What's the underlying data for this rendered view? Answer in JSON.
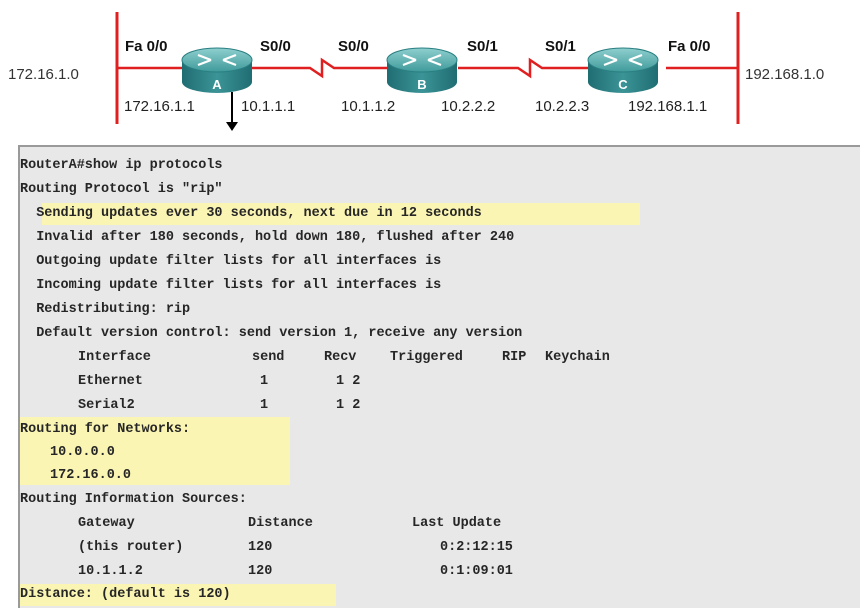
{
  "topology": {
    "networks": {
      "left": "172.16.1.0",
      "right": "192.168.1.0"
    },
    "routers": [
      {
        "name": "A",
        "color": "#3a8f8f"
      },
      {
        "name": "B",
        "color": "#3a8f8f"
      },
      {
        "name": "C",
        "color": "#3a8f8f"
      }
    ],
    "interfaces": {
      "a_fa": "Fa 0/0",
      "a_s": "S0/0",
      "b_s_left": "S0/0",
      "b_s_right": "S0/1",
      "c_s": "S0/1",
      "c_fa": "Fa 0/0"
    },
    "addresses": {
      "a_fa": "172.16.1.1",
      "a_s": "10.1.1.1",
      "b_left": "10.1.1.2",
      "b_right": "10.2.2.2",
      "c_s": "10.2.2.3",
      "c_fa": "192.168.1.1"
    },
    "colors": {
      "segment": "#e02020",
      "serial_link": "#e02020"
    }
  },
  "terminal": {
    "prompt": "RouterA#show ip protocols",
    "protocol": "Routing Protocol is \"rip\"",
    "sending": "  Sending updates ever 30 seconds, next due in 12 seconds",
    "invalid": "  Invalid after 180 seconds, hold down 180, flushed after 240",
    "outgoing": "  Outgoing update filter lists for all interfaces is",
    "incoming": "  Incoming update filter lists for all interfaces is",
    "redistributing": "  Redistributing: rip",
    "default_version": "  Default version control: send version 1, receive any version",
    "interface_table": {
      "headers": [
        "Interface",
        "send",
        "Recv",
        "Triggered",
        "RIP",
        "Keychain"
      ],
      "rows": [
        [
          "Ethernet",
          "1",
          "1 2"
        ],
        [
          "Serial2",
          "1",
          "1 2"
        ]
      ]
    },
    "routing_for_networks": "Routing for Networks:",
    "networks": [
      "10.0.0.0",
      "172.16.0.0"
    ],
    "info_sources": "Routing Information Sources:",
    "sources_table": {
      "headers": [
        "Gateway",
        "Distance",
        "Last Update"
      ],
      "rows": [
        [
          "(this router)",
          "120",
          "0:2:12:15"
        ],
        [
          "10.1.1.2",
          "120",
          "0:1:09:01"
        ]
      ]
    },
    "distance": "Distance: (default is 120)",
    "highlight_color": "#fbf5b3"
  }
}
